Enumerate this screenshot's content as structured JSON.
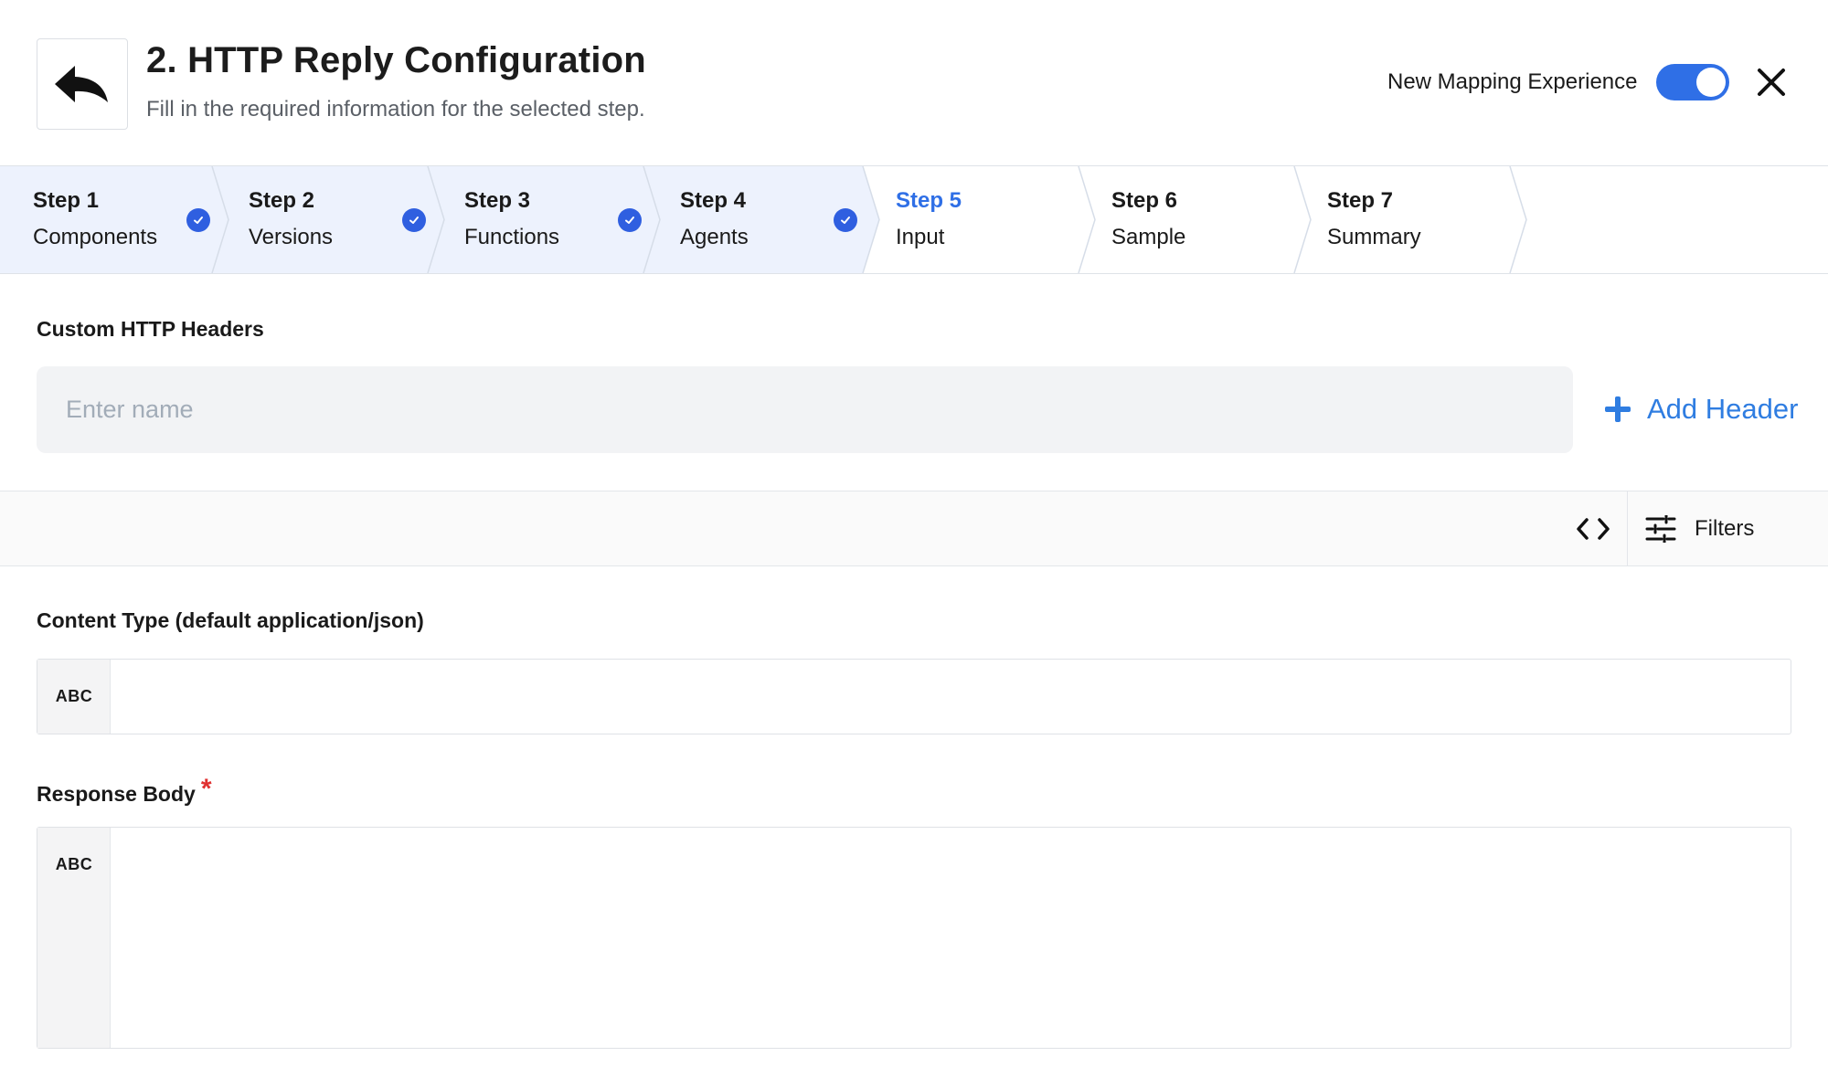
{
  "header": {
    "title": "2. HTTP Reply Configuration",
    "subtitle": "Fill in the required information for the selected step.",
    "toggle_label": "New Mapping Experience",
    "toggle_on": true
  },
  "stepper": {
    "steps": [
      {
        "num": "Step 1",
        "label": "Components",
        "state": "done"
      },
      {
        "num": "Step 2",
        "label": "Versions",
        "state": "done"
      },
      {
        "num": "Step 3",
        "label": "Functions",
        "state": "done"
      },
      {
        "num": "Step 4",
        "label": "Agents",
        "state": "done"
      },
      {
        "num": "Step 5",
        "label": "Input",
        "state": "active"
      },
      {
        "num": "Step 6",
        "label": "Sample",
        "state": "pending"
      },
      {
        "num": "Step 7",
        "label": "Summary",
        "state": "pending"
      }
    ]
  },
  "custom_headers": {
    "label": "Custom HTTP Headers",
    "name_placeholder": "Enter name",
    "name_value": "",
    "add_label": "Add Header"
  },
  "toolbar": {
    "filters_label": "Filters"
  },
  "fields": {
    "content_type": {
      "label": "Content Type (default application/json)",
      "type": "ABC",
      "value": ""
    },
    "response_body": {
      "label": "Response Body",
      "required": "*",
      "type": "ABC",
      "value": ""
    }
  },
  "colors": {
    "accent": "#2f6fe6",
    "done_step_bg": "#edf2fd",
    "required": "#e03131",
    "link": "#2f7de1"
  },
  "icons": {
    "back": "reply-arrow-icon",
    "close": "close-icon",
    "check": "check-circle-icon",
    "add": "plus-icon",
    "code": "code-brackets-icon",
    "filters": "sliders-icon"
  }
}
